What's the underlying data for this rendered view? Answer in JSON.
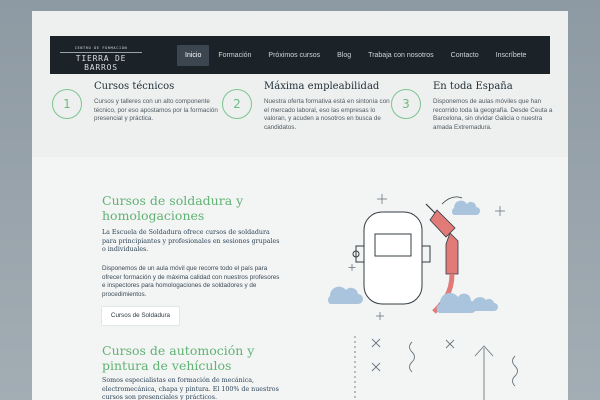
{
  "brand": {
    "tagline": "CENTRO DE FORMACIÓN",
    "name": "TIERRA DE BARROS"
  },
  "nav": {
    "items": [
      {
        "label": "Inicio",
        "active": true
      },
      {
        "label": "Formación"
      },
      {
        "label": "Próximos cursos"
      },
      {
        "label": "Blog"
      },
      {
        "label": "Trabaja con nosotros"
      },
      {
        "label": "Contacto"
      },
      {
        "label": "Inscríbete"
      }
    ]
  },
  "features": [
    {
      "number": "1",
      "title": "Cursos técnicos",
      "text": "Cursos y talleres con un alto componente técnico, por eso apostamos por la formación presencial y práctica."
    },
    {
      "number": "2",
      "title": "Máxima empleabilidad",
      "text": "Nuestra oferta formativa está en sintonía con el mercado laboral, eso las empresas lo valoran, y acuden a nosotros en busca de candidatos."
    },
    {
      "number": "3",
      "title": "En toda España",
      "text": "Disponemos de aulas móviles que han recorrido toda la geografía. Desde Ceuta a Barcelona, sin olvidar Galicia o nuestra amada Extremadura."
    }
  ],
  "welding": {
    "title": "Cursos de soldadura y homologaciones",
    "intro": "La Escuela de Soldadura ofrece cursos de soldadura para principiantes y profesionales en sesiones grupales o individuales.",
    "body": "Disponemos de un aula móvil que recorre todo el país para ofrecer formación y de máxima calidad con nuestros profesores e inspectores para homologaciones de soldadores y de procedimientos.",
    "button": "Cursos de Soldadura"
  },
  "automotive": {
    "title": "Cursos de automoción y pintura de vehículos",
    "intro": "Somos especialistas en formación de mecánica, electromecánica, chapa y pintura. El 100% de nuestros cursos son presenciales y prácticos."
  },
  "colors": {
    "accent_green": "#61b274",
    "nav_bg": "#1b2328",
    "welding_red": "#e07b78",
    "cloud_blue": "#a9c4dc"
  }
}
